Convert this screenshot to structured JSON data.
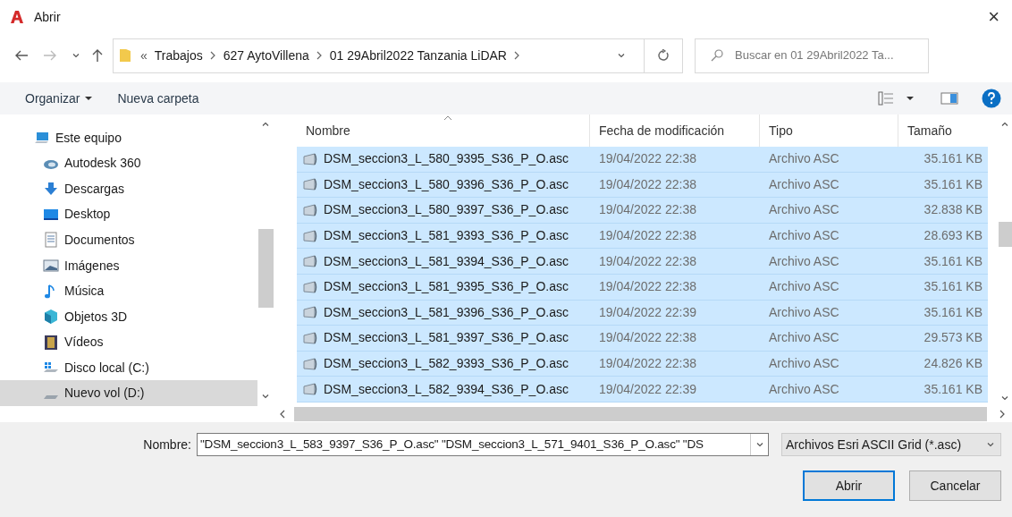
{
  "window": {
    "title": "Abrir",
    "close": "×"
  },
  "address": {
    "overflow": "«",
    "crumbs": [
      "Trabajos",
      "627 AytoVillena",
      "01 29Abril2022 Tanzania LiDAR"
    ]
  },
  "search": {
    "placeholder": "Buscar en 01 29Abril2022 Ta..."
  },
  "toolbar": {
    "organize": "Organizar",
    "new_folder": "Nueva carpeta"
  },
  "sidebar": {
    "items": [
      {
        "label": "Este equipo",
        "kind": "computer",
        "selected": false
      },
      {
        "label": "Autodesk 360",
        "kind": "cloud",
        "selected": false
      },
      {
        "label": "Descargas",
        "kind": "download",
        "selected": false
      },
      {
        "label": "Desktop",
        "kind": "desktop",
        "selected": false
      },
      {
        "label": "Documentos",
        "kind": "document",
        "selected": false
      },
      {
        "label": "Imágenes",
        "kind": "pictures",
        "selected": false
      },
      {
        "label": "Música",
        "kind": "music",
        "selected": false
      },
      {
        "label": "Objetos 3D",
        "kind": "cube",
        "selected": false
      },
      {
        "label": "Vídeos",
        "kind": "film",
        "selected": false
      },
      {
        "label": "Disco local (C:)",
        "kind": "windrive",
        "selected": false
      },
      {
        "label": "Nuevo vol (D:)",
        "kind": "drive",
        "selected": true
      }
    ]
  },
  "table": {
    "columns": [
      "Nombre",
      "Fecha de modificación",
      "Tipo",
      "Tamaño"
    ],
    "rows": [
      {
        "name": "DSM_seccion3_L_580_9395_S36_P_O.asc",
        "date": "19/04/2022 22:38",
        "type": "Archivo ASC",
        "size": "35.161 KB",
        "selected": true
      },
      {
        "name": "DSM_seccion3_L_580_9396_S36_P_O.asc",
        "date": "19/04/2022 22:38",
        "type": "Archivo ASC",
        "size": "35.161 KB",
        "selected": true
      },
      {
        "name": "DSM_seccion3_L_580_9397_S36_P_O.asc",
        "date": "19/04/2022 22:38",
        "type": "Archivo ASC",
        "size": "32.838 KB",
        "selected": true
      },
      {
        "name": "DSM_seccion3_L_581_9393_S36_P_O.asc",
        "date": "19/04/2022 22:38",
        "type": "Archivo ASC",
        "size": "28.693 KB",
        "selected": true
      },
      {
        "name": "DSM_seccion3_L_581_9394_S36_P_O.asc",
        "date": "19/04/2022 22:38",
        "type": "Archivo ASC",
        "size": "35.161 KB",
        "selected": true
      },
      {
        "name": "DSM_seccion3_L_581_9395_S36_P_O.asc",
        "date": "19/04/2022 22:38",
        "type": "Archivo ASC",
        "size": "35.161 KB",
        "selected": true
      },
      {
        "name": "DSM_seccion3_L_581_9396_S36_P_O.asc",
        "date": "19/04/2022 22:39",
        "type": "Archivo ASC",
        "size": "35.161 KB",
        "selected": true
      },
      {
        "name": "DSM_seccion3_L_581_9397_S36_P_O.asc",
        "date": "19/04/2022 22:38",
        "type": "Archivo ASC",
        "size": "29.573 KB",
        "selected": true
      },
      {
        "name": "DSM_seccion3_L_582_9393_S36_P_O.asc",
        "date": "19/04/2022 22:38",
        "type": "Archivo ASC",
        "size": "24.826 KB",
        "selected": true
      },
      {
        "name": "DSM_seccion3_L_582_9394_S36_P_O.asc",
        "date": "19/04/2022 22:39",
        "type": "Archivo ASC",
        "size": "35.161 KB",
        "selected": true
      }
    ]
  },
  "filename": {
    "label": "Nombre:",
    "value": "\"DSM_seccion3_L_583_9397_S36_P_O.asc\" \"DSM_seccion3_L_571_9401_S36_P_O.asc\" \"DS"
  },
  "filter": {
    "value": "Archivos Esri ASCII Grid (*.asc)"
  },
  "buttons": [
    {
      "label": "Abrir",
      "kind": "default"
    },
    {
      "label": "Cancelar",
      "kind": "normal"
    }
  ]
}
